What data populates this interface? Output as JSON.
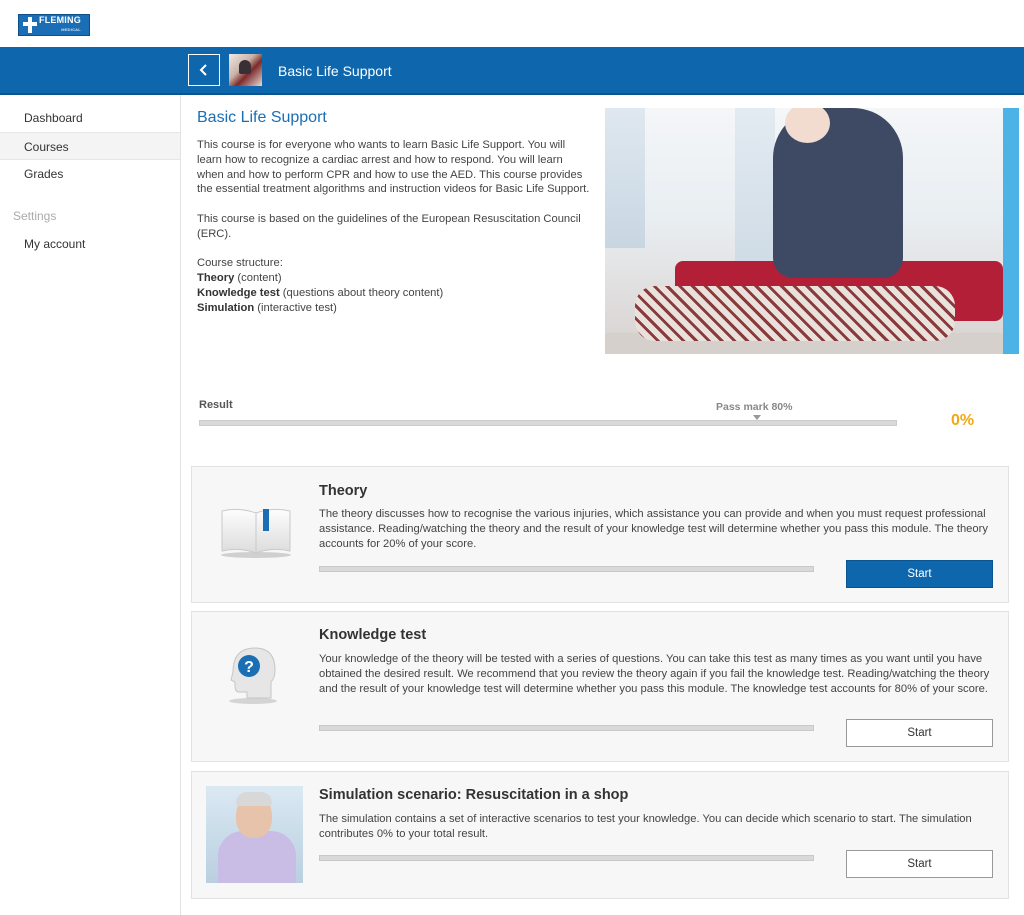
{
  "brand": {
    "logo_text": "FLEMING",
    "logo_sub": "MEDICAL"
  },
  "header": {
    "back_icon": "chevron-left-icon",
    "title": "Basic Life Support"
  },
  "sidebar": {
    "items": [
      {
        "label": "Dashboard",
        "active": false
      },
      {
        "label": "Courses",
        "active": true
      },
      {
        "label": "Grades",
        "active": false
      }
    ],
    "settings_heading": "Settings",
    "settings_items": [
      {
        "label": "My account"
      }
    ]
  },
  "course": {
    "title": "Basic Life Support",
    "intro_p1": "This course is for everyone who wants to learn Basic Life Support. You will learn how to recognize a cardiac arrest and how to respond. You will learn when and how to perform CPR and how to use the AED. This course provides the essential treatment algorithms and instruction videos for Basic Life Support.",
    "intro_p2": "This course is based on the guidelines of the European Resuscitation Council (ERC).",
    "structure_heading": "Course structure:",
    "structure": [
      {
        "bold": "Theory",
        "rest": " (content)"
      },
      {
        "bold": "Knowledge test",
        "rest": " (questions about theory content)"
      },
      {
        "bold": "Simulation",
        "rest": " (interactive test)"
      }
    ]
  },
  "result": {
    "label": "Result",
    "pass_mark_label": "Pass mark 80%",
    "pass_mark": 0.8,
    "value": 0,
    "value_text": "0%",
    "accent": "#f3a712"
  },
  "modules": [
    {
      "title": "Theory",
      "icon": "book-icon",
      "description": "The theory discusses how to recognise the various injuries, which assistance you can provide and when you must request professional assistance. Reading/watching the theory and the result of your knowledge test will determine whether you pass this module. The theory accounts for 20% of your score.",
      "progress": 0,
      "button_label": "Start",
      "button_style": "primary"
    },
    {
      "title": "Knowledge test",
      "icon": "question-head-icon",
      "description": "Your knowledge of the theory will be tested with a series of questions. You can take this test as many times as you want until you have obtained the desired result. We recommend that you review the theory again if you fail the knowledge test. Reading/watching the theory and the result of your knowledge test will determine whether you pass this module. The knowledge test accounts for 80% of your score.",
      "progress": 0,
      "button_label": "Start",
      "button_style": "secondary"
    },
    {
      "title": "Simulation scenario: Resuscitation in a shop",
      "icon": "simulation-thumbnail",
      "description": "The simulation contains a set of interactive scenarios to test your knowledge. You can decide which scenario to start. The simulation contributes 0% to your total result.",
      "progress": 0,
      "button_label": "Start",
      "button_style": "secondary"
    }
  ],
  "colors": {
    "brand_blue": "#0e67ad",
    "title_blue": "#1a6fb4",
    "hero_accent": "#4db3e6"
  }
}
